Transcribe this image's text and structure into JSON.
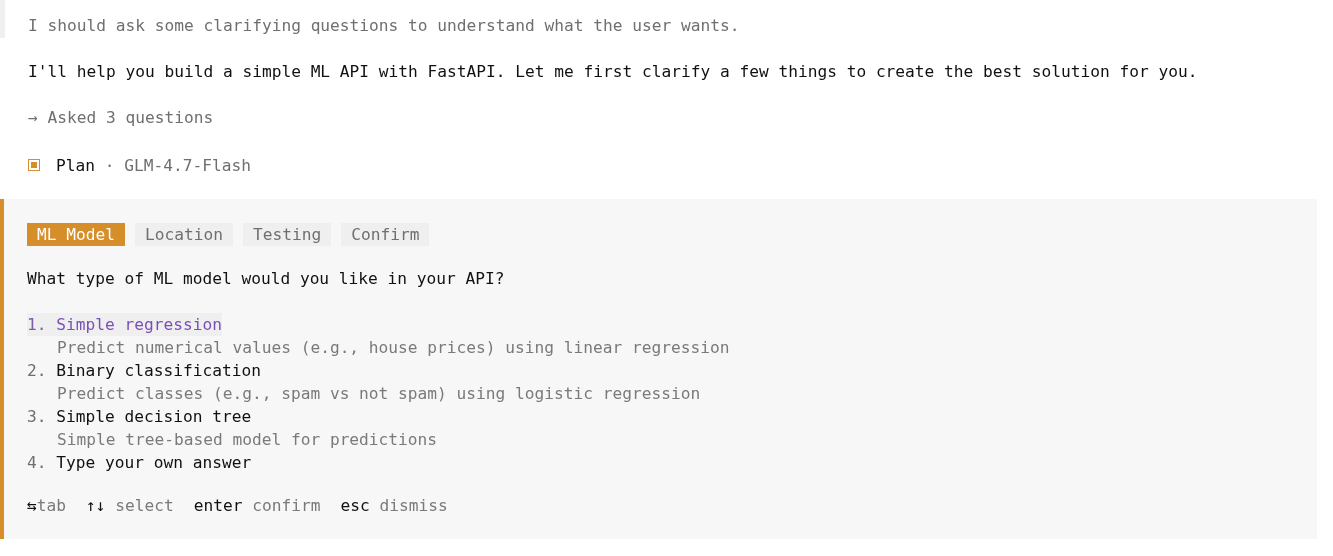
{
  "thinking": "I should ask some clarifying questions to understand what the user wants.",
  "reply": "I'll help you build a simple ML API with FastAPI. Let me first clarify a few things to create the best solution for you.",
  "tool_call": "→ Asked 3 questions",
  "mode": {
    "name": "Plan",
    "separator": "·",
    "model": "GLM-4.7-Flash"
  },
  "question_panel": {
    "tabs": [
      {
        "label": "ML Model",
        "selected": true
      },
      {
        "label": "Location",
        "selected": false
      },
      {
        "label": "Testing",
        "selected": false
      },
      {
        "label": "Confirm",
        "selected": false
      }
    ],
    "question": "What type of ML model would you like in your API?",
    "options": [
      {
        "number": "1.",
        "label": "Simple regression",
        "description": "Predict numerical values (e.g., house prices) using linear regression",
        "selected": true
      },
      {
        "number": "2.",
        "label": "Binary classification",
        "description": "Predict classes (e.g., spam vs not spam) using logistic regression",
        "selected": false
      },
      {
        "number": "3.",
        "label": "Simple decision tree",
        "description": "Simple tree-based model for predictions",
        "selected": false
      },
      {
        "number": "4.",
        "label": "Type your own answer",
        "selected": false
      }
    ],
    "hints": [
      {
        "key": "⇆",
        "label": "tab"
      },
      {
        "key": "↑↓",
        "label": "select"
      },
      {
        "key": "enter",
        "label": "confirm"
      },
      {
        "key": "esc",
        "label": "dismiss"
      }
    ]
  }
}
